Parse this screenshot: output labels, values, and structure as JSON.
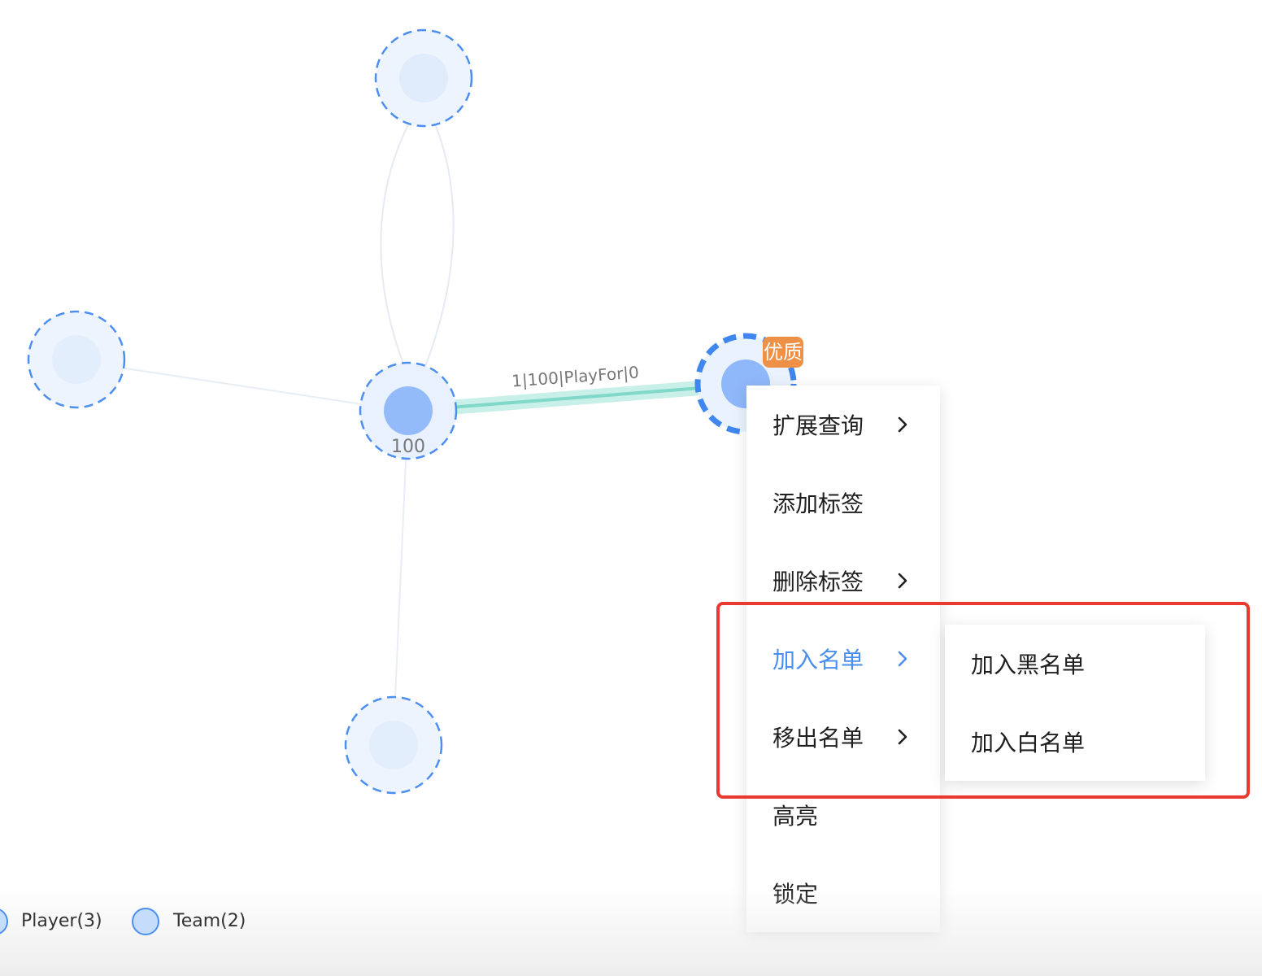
{
  "graph": {
    "edge_label": "1|100|PlayFor|0",
    "center_node_label": "100",
    "selected_node_tag": "优质",
    "colors": {
      "node_fill": "#8fb8fa",
      "node_border": "#3f86ee",
      "edge_highlight": "#7fd8c8"
    }
  },
  "context_menu": {
    "items": [
      {
        "label": "扩展查询",
        "has_submenu": true
      },
      {
        "label": "添加标签",
        "has_submenu": false
      },
      {
        "label": "删除标签",
        "has_submenu": true
      },
      {
        "label": "加入名单",
        "has_submenu": true,
        "active": true
      },
      {
        "label": "移出名单",
        "has_submenu": true
      },
      {
        "label": "高亮",
        "has_submenu": false
      },
      {
        "label": "锁定",
        "has_submenu": false
      }
    ],
    "submenu": [
      {
        "label": "加入黑名单"
      },
      {
        "label": "加入白名单"
      }
    ],
    "active_color": "#4a8ff0",
    "highlight_color": "#e83a2e"
  },
  "legend": {
    "items": [
      {
        "label": "Player(3)",
        "icon": "circle-icon"
      },
      {
        "label": "Team(2)",
        "icon": "circle-icon"
      }
    ]
  }
}
